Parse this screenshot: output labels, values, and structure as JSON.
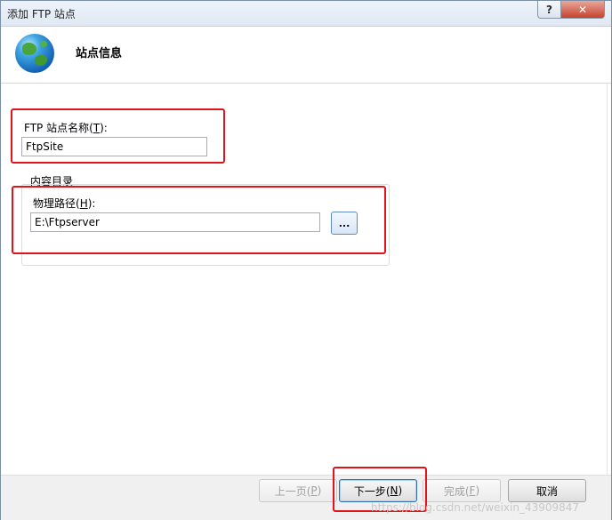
{
  "window": {
    "title": "添加 FTP 站点",
    "help_glyph": "?",
    "close_glyph": "✕"
  },
  "header": {
    "title": "站点信息",
    "icon": "globe-icon"
  },
  "site_name": {
    "label_prefix": "FTP 站点名称(",
    "label_accel": "T",
    "label_suffix": "):",
    "value": "FtpSite"
  },
  "content_dir": {
    "group_label": "内容目录",
    "path_label_prefix": "物理路径(",
    "path_label_accel": "H",
    "path_label_suffix": "):",
    "path_value": "E:\\Ftpserver",
    "browse_label": "..."
  },
  "footer": {
    "prev": {
      "prefix": "上一页(",
      "accel": "P",
      "suffix": ")"
    },
    "next": {
      "prefix": "下一步(",
      "accel": "N",
      "suffix": ")"
    },
    "finish": {
      "prefix": "完成(",
      "accel": "F",
      "suffix": ")"
    },
    "cancel": "取消",
    "watermark": "https://blog.csdn.net/weixin_43909847"
  },
  "colors": {
    "highlight": "#e0141a",
    "title_bar": "#dfe8f3",
    "close_button": "#c5432d"
  }
}
